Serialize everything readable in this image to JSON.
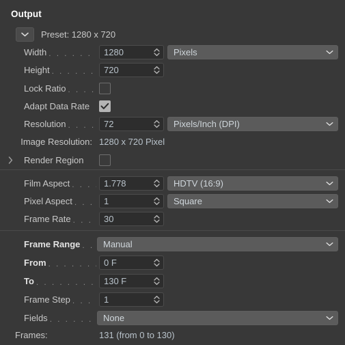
{
  "panel": {
    "title": "Output",
    "preset_label": "Preset: 1280 x 720",
    "collapse_icon": "chevron-down-icon"
  },
  "colors": {
    "background": "#383838",
    "field_background": "#2d2d2d",
    "dropdown_background": "#5b5b5b",
    "value_text": "#b9c3cb",
    "label_text": "#c9c9c9",
    "title_text": "#ffffff",
    "divider": "#4a4a4a",
    "checkbox_checked": "#b4b4b4"
  },
  "sections": {
    "resolution": {
      "width": {
        "label": "Width",
        "leader": ". . . . . . . . .",
        "value": "1280",
        "unit": "Pixels"
      },
      "height": {
        "label": "Height",
        "leader": ". . . . . . . .",
        "value": "720"
      },
      "lock_ratio": {
        "label": "Lock Ratio",
        "leader": ". . . .",
        "checked": false
      },
      "adapt_data_rate": {
        "label": "Adapt Data Rate",
        "leader": "",
        "checked": true
      },
      "resolution": {
        "label": "Resolution",
        "leader": ". . . .",
        "value": "72",
        "unit": "Pixels/Inch (DPI)"
      },
      "image_resolution": {
        "label": "Image Resolution:",
        "value": "1280 x 720 Pixel"
      },
      "render_region": {
        "label": "Render Region",
        "checked": false,
        "expand_icon": "chevron-right-icon"
      }
    },
    "aspect": {
      "film_aspect": {
        "label": "Film Aspect",
        "leader": ". . . .",
        "value": "1.778",
        "preset": "HDTV (16:9)"
      },
      "pixel_aspect": {
        "label": "Pixel Aspect",
        "leader": ". . .",
        "value": "1",
        "preset": "Square"
      },
      "frame_rate": {
        "label": "Frame Rate",
        "leader": ". . . .",
        "value": "30"
      }
    },
    "frame_range": {
      "range_mode": {
        "label": "Frame Range",
        "leader": ". .",
        "value": "Manual"
      },
      "from": {
        "label": "From",
        "leader": ". . . . . . . . .",
        "value": "0 F"
      },
      "to": {
        "label": "To",
        "leader": ". . . . . . . . . . .",
        "value": "130 F"
      },
      "frame_step": {
        "label": "Frame Step",
        "leader": ". . . .",
        "value": "1"
      },
      "fields": {
        "label": "Fields",
        "leader": ". . . . . . . . .",
        "value": "None"
      },
      "frames_summary": {
        "label": "Frames:",
        "value": "131 (from 0 to 130)"
      }
    }
  }
}
